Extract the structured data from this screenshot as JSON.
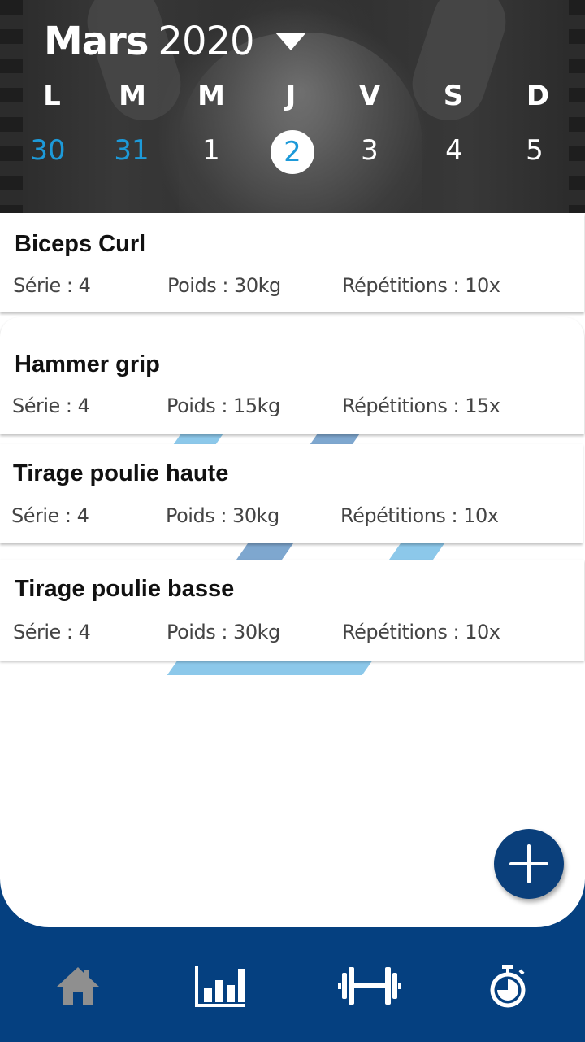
{
  "calendar": {
    "month": "Mars",
    "year": "2020",
    "weekdays": [
      "L",
      "M",
      "M",
      "J",
      "V",
      "S",
      "D"
    ],
    "days": [
      "30",
      "31",
      "1",
      "2",
      "3",
      "4",
      "5"
    ],
    "selected_day": "2"
  },
  "exercises": [
    {
      "name": "Biceps Curl",
      "series": "Série : 4",
      "weight": "Poids : 30kg",
      "reps": "Répétitions : 10x"
    },
    {
      "name": "Hammer grip",
      "series": "Série : 4",
      "weight": "Poids : 15kg",
      "reps": "Répétitions : 15x"
    },
    {
      "name": "Tirage poulie haute",
      "series": "Série : 4",
      "weight": "Poids : 30kg",
      "reps": "Répétitions : 10x"
    },
    {
      "name": "Tirage poulie basse",
      "series": "Série : 4",
      "weight": "Poids : 30kg",
      "reps": "Répétitions : 10x"
    }
  ],
  "fab": {
    "icon": "plus-icon"
  },
  "nav": {
    "items": [
      {
        "icon": "home-icon",
        "active": true
      },
      {
        "icon": "bar-chart-icon",
        "active": false
      },
      {
        "icon": "dumbbell-icon",
        "active": false
      },
      {
        "icon": "stopwatch-icon",
        "active": false
      }
    ]
  },
  "colors": {
    "primary": "#054080",
    "accent": "#1d9ad9",
    "stripe_light": "#8cc8ea",
    "stripe_mid": "#7ea7cf",
    "nav_inactive": "#8f8f8f"
  }
}
